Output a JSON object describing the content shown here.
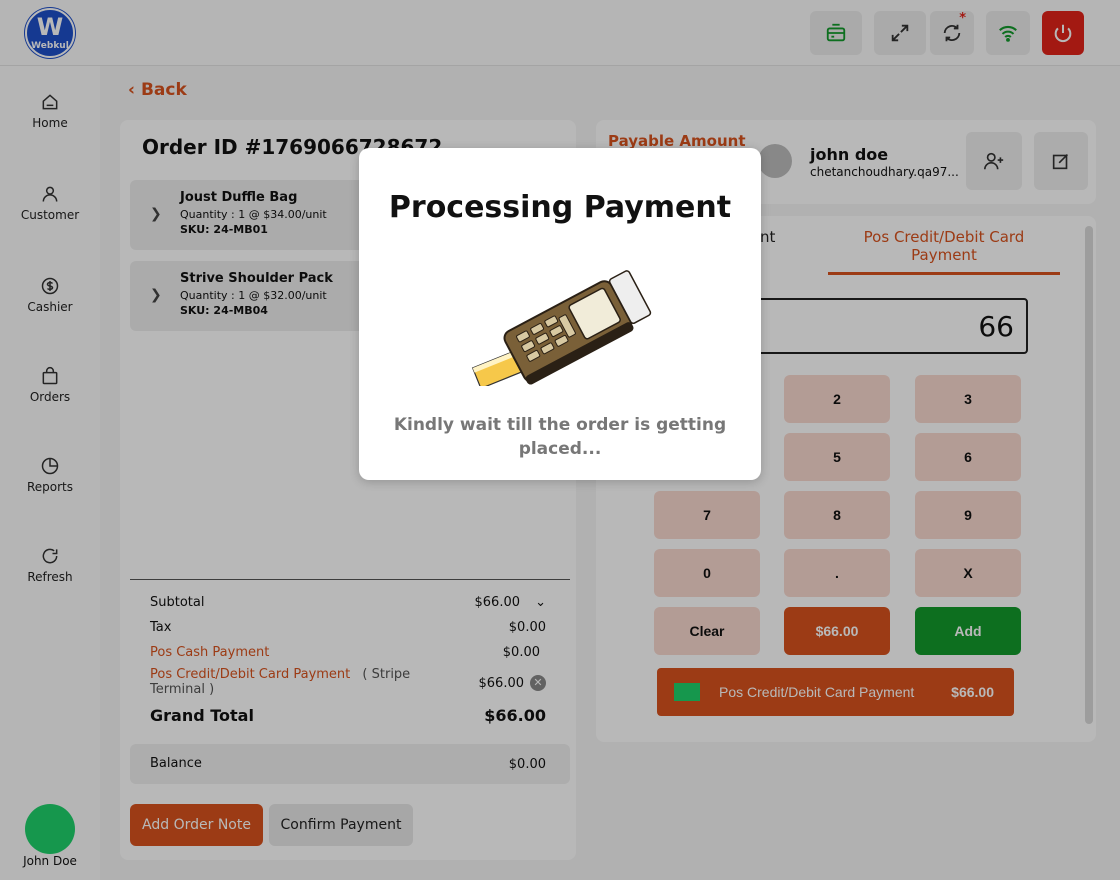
{
  "header": {
    "logo_text": "Webkul",
    "logo_letter": "W"
  },
  "sidebar": {
    "items": [
      {
        "label": "Home",
        "icon": "home-icon"
      },
      {
        "label": "Customer",
        "icon": "user-icon"
      },
      {
        "label": "Cashier",
        "icon": "dollar-icon"
      },
      {
        "label": "Orders",
        "icon": "bag-icon"
      },
      {
        "label": "Reports",
        "icon": "pie-chart-icon"
      },
      {
        "label": "Refresh",
        "icon": "refresh-icon"
      }
    ],
    "user_name": "John Doe"
  },
  "back_label": "Back",
  "order": {
    "title": "Order ID #1769066728672",
    "items": [
      {
        "name": "Joust Duffle Bag",
        "qty": "Quantity : 1 @ $34.00/unit",
        "sku": "SKU: 24-MB01"
      },
      {
        "name": "Strive Shoulder Pack",
        "qty": "Quantity : 1 @ $32.00/unit",
        "sku": "SKU: 24-MB04"
      }
    ],
    "totals": {
      "subtotal_label": "Subtotal",
      "subtotal": "$66.00",
      "tax_label": "Tax",
      "tax": "$0.00",
      "cash_label": "Pos Cash Payment",
      "cash": "$0.00",
      "card_label": "Pos Credit/Debit Card Payment",
      "card_note": "( Stripe",
      "card_note2": "Terminal )",
      "card": "$66.00",
      "grand_label": "Grand Total",
      "grand": "$66.00",
      "balance_label": "Balance",
      "balance": "$0.00"
    },
    "add_note_label": "Add Order Note",
    "confirm_label": "Confirm Payment"
  },
  "customer": {
    "payable_label": "Payable Amount",
    "name": "john doe",
    "email": "chetanchoudhary.qa97..."
  },
  "payment": {
    "tab_left_fragment": "nt",
    "tab_right_line1": "Pos Credit/Debit Card",
    "tab_right_line2": "Payment",
    "amount": "66",
    "keys": [
      "2",
      "3",
      "5",
      "6",
      "7",
      "8",
      "9",
      "0",
      ".",
      "X",
      "Clear",
      "$66.00",
      "Add"
    ],
    "line_label": "Pos Credit/Debit Card Payment",
    "line_amount": "$66.00"
  },
  "modal": {
    "title": "Processing Payment",
    "message": "Kindly wait till the order is getting placed..."
  },
  "colors": {
    "accent": "#d9531e",
    "success": "#139a2c",
    "danger": "#e2231a",
    "keypad": "#f9d9cf",
    "brand": "#1e4fc9"
  }
}
